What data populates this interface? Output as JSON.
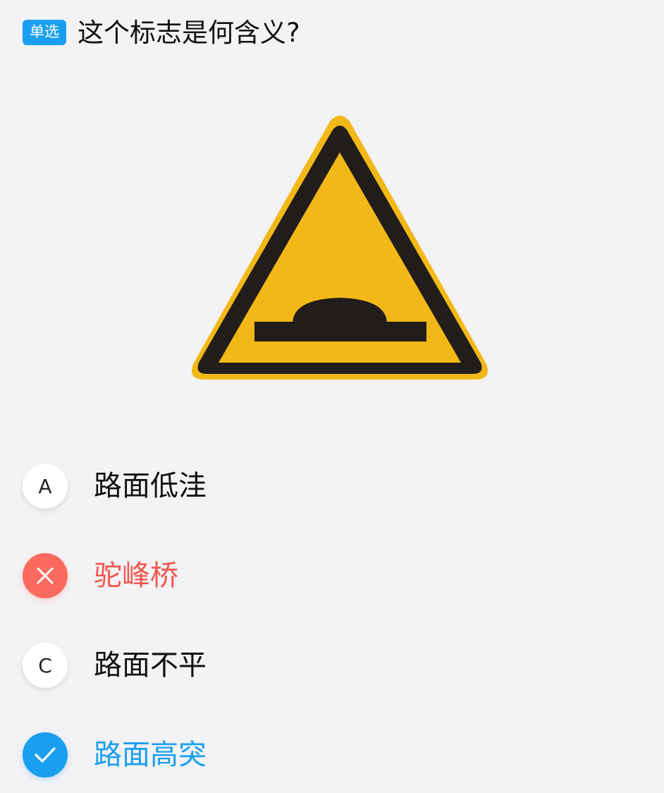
{
  "question": {
    "type_badge": "单选",
    "text": "这个标志是何含义?"
  },
  "sign": {
    "icon": "warning-triangle-hump-road-sign",
    "colors": {
      "fill": "#f2b817",
      "border": "#211d1b",
      "symbol": "#211d1b"
    }
  },
  "options": [
    {
      "marker": "A",
      "text": "路面低洼",
      "state": "unselected"
    },
    {
      "marker": "",
      "marker_icon": "close-x-icon",
      "text": "驼峰桥",
      "state": "wrong"
    },
    {
      "marker": "C",
      "text": "路面不平",
      "state": "unselected"
    },
    {
      "marker": "",
      "marker_icon": "check-icon",
      "text": "路面高突",
      "state": "correct"
    }
  ],
  "colors": {
    "accent": "#1a9ff0",
    "wrong": "#fb6a5e",
    "background": "#f3f2f5"
  }
}
